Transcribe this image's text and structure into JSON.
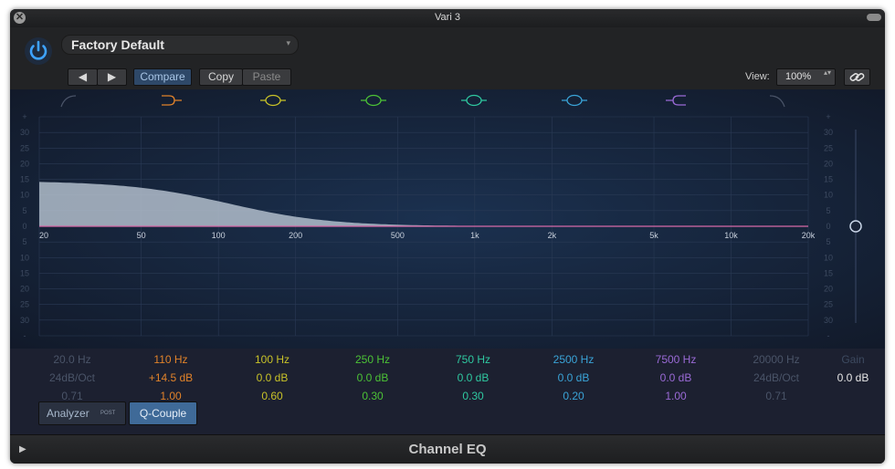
{
  "window": {
    "title": "Vari 3",
    "close_glyph": "✕",
    "footer_title": "Channel EQ",
    "footer_arrow": "▶"
  },
  "header": {
    "power_icon": "power-icon",
    "preset_name": "Factory Default",
    "preset_caret": "▾",
    "prev_glyph": "◀",
    "next_glyph": "▶",
    "compare_label": "Compare",
    "copy_label": "Copy",
    "paste_label": "Paste",
    "view_label": "View:",
    "view_zoom": "100%",
    "zoom_arrows": "▴▾",
    "link_icon": "link-icon"
  },
  "graph": {
    "db_ticks": [
      "+",
      "30",
      "25",
      "20",
      "15",
      "10",
      "5",
      "0",
      "5",
      "10",
      "15",
      "20",
      "25",
      "30",
      "-"
    ],
    "freq_labels": [
      "20",
      "50",
      "100",
      "200",
      "500",
      "1k",
      "2k",
      "5k",
      "10k",
      "20k"
    ],
    "freq_values": [
      20,
      50,
      100,
      200,
      500,
      1000,
      2000,
      5000,
      10000,
      20000
    ],
    "gain_ticks": [
      "+",
      "30",
      "25",
      "20",
      "15",
      "10",
      "5",
      "0",
      "5",
      "10",
      "15",
      "20",
      "25",
      "30",
      "-"
    ],
    "curve_low_shelf_db": 14.5,
    "curve_low_shelf_freq": 110,
    "accent_curve": "#d66aa8",
    "fill_color": "#b7c3d1"
  },
  "bands": [
    {
      "freq": "20.0 Hz",
      "gain": "24dB/Oct",
      "q": "0.71",
      "color": "#4a5468",
      "icon": "low-cut-icon"
    },
    {
      "freq": "110 Hz",
      "gain": "+14.5 dB",
      "q": "1.00",
      "color": "#e0822a",
      "icon": "low-shelf-icon"
    },
    {
      "freq": "100 Hz",
      "gain": "0.0 dB",
      "q": "0.60",
      "color": "#c8c228",
      "icon": "bell-band-1-icon"
    },
    {
      "freq": "250 Hz",
      "gain": "0.0 dB",
      "q": "0.30",
      "color": "#4cc236",
      "icon": "bell-band-2-icon"
    },
    {
      "freq": "750 Hz",
      "gain": "0.0 dB",
      "q": "0.30",
      "color": "#2fc8a0",
      "icon": "bell-band-3-icon"
    },
    {
      "freq": "2500 Hz",
      "gain": "0.0 dB",
      "q": "0.20",
      "color": "#3aa4d8",
      "icon": "bell-band-4-icon"
    },
    {
      "freq": "7500 Hz",
      "gain": "0.0 dB",
      "q": "1.00",
      "color": "#9a6ad6",
      "icon": "high-shelf-icon"
    },
    {
      "freq": "20000 Hz",
      "gain": "24dB/Oct",
      "q": "0.71",
      "color": "#4a5468",
      "icon": "high-cut-icon"
    }
  ],
  "gain_param": {
    "label": "Gain",
    "value": "0.0 dB"
  },
  "buttons": {
    "analyzer_label": "Analyzer",
    "analyzer_post": "POST",
    "qcouple_label": "Q-Couple"
  }
}
